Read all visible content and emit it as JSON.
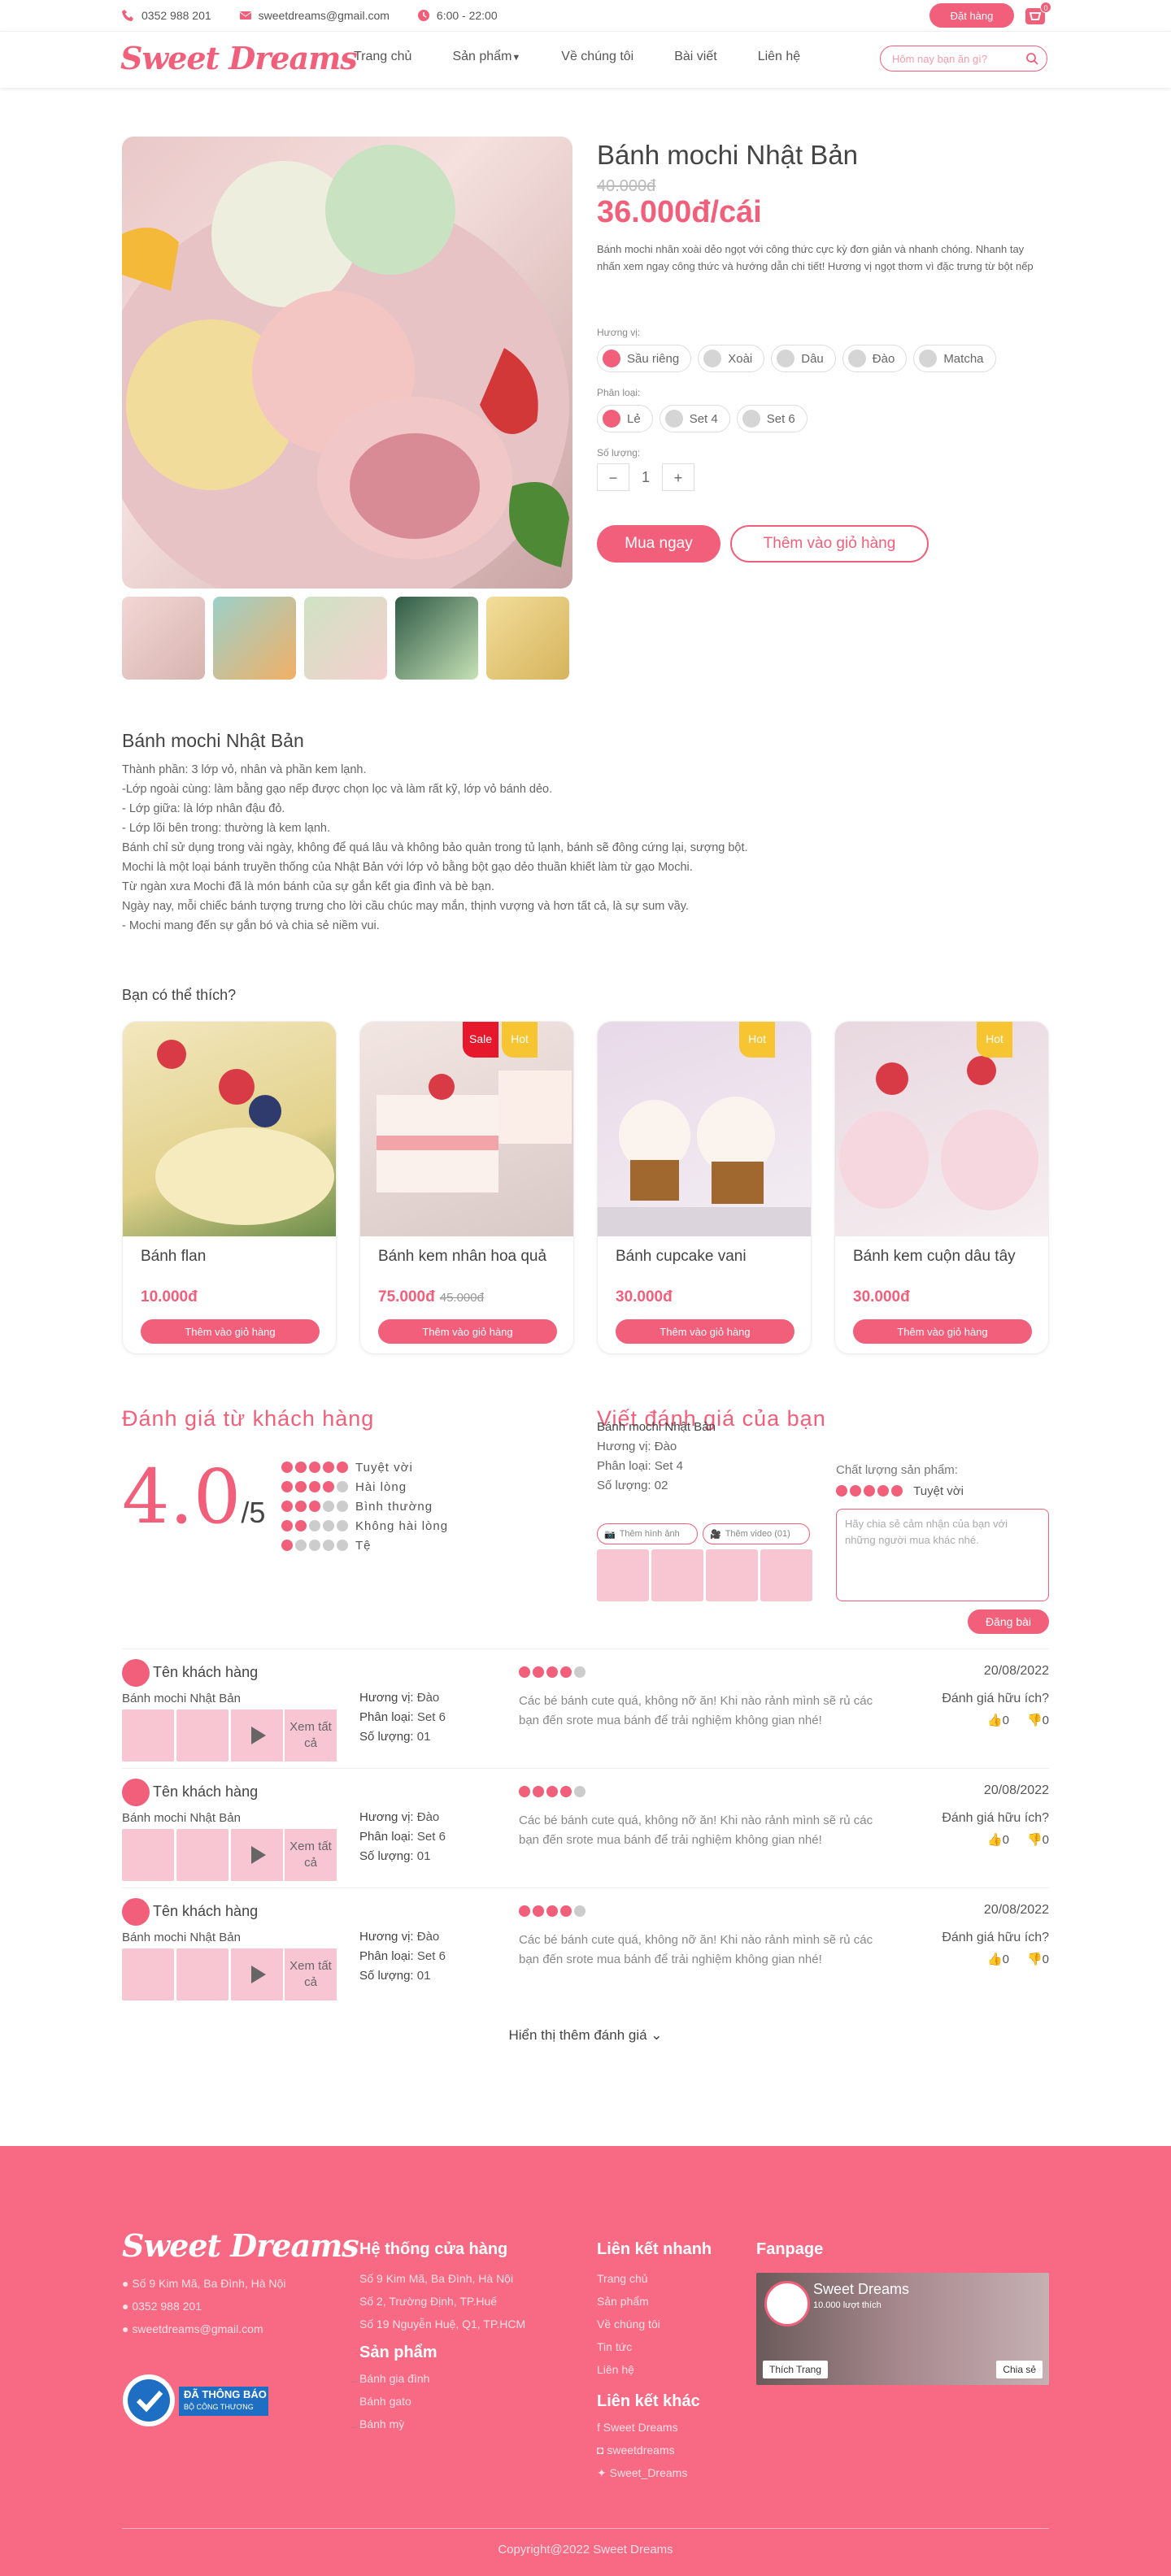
{
  "topbar": {
    "phone": "0352 988 201",
    "email": "sweetdreams@gmail.com",
    "hours": "6:00 - 22:00",
    "order_label": "Đặt hàng",
    "cart_count": "0"
  },
  "nav": {
    "logo": "Sweet Dreams",
    "items": [
      "Trang chủ",
      "Sản phẩm",
      "Về chúng tôi",
      "Bài viết",
      "Liên hệ"
    ],
    "search_placeholder": "Hôm nay bạn ăn gì?"
  },
  "product": {
    "title": "Bánh mochi Nhật Bản",
    "old_price": "40.000đ",
    "price": "36.000đ/cái",
    "description": "Bánh mochi nhân xoài dẻo ngọt với công thức cực kỳ đơn giản và nhanh chóng. Nhanh tay nhấn xem ngay công thức và hướng dẫn chi tiết! Hương vị ngọt thơm vì đặc trưng từ bột nếp",
    "flavor_label": "Hương vị:",
    "flavors": [
      "Sầu riêng",
      "Xoài",
      "Dâu",
      "Đào",
      "Matcha"
    ],
    "type_label": "Phân loại:",
    "types": [
      "Lẻ",
      "Set 4",
      "Set 6"
    ],
    "qty_label": "Số lượng:",
    "qty": "1",
    "buy_label": "Mua ngay",
    "add_label": "Thêm vào giỏ hàng"
  },
  "details": {
    "title": "Bánh mochi Nhật Bản",
    "lines": [
      "Thành phần: 3 lớp vỏ, nhân và phần kem lạnh.",
      "-Lớp ngoài cùng: làm bằng gạo nếp được chọn lọc và làm rất kỹ, lớp vỏ bánh dẻo.",
      "- Lớp giữa: là lớp nhân đậu đỏ.",
      "- Lớp lõi bên trong: thường là kem lạnh.",
      "Bánh chỉ sử dụng trong vài ngày, không để quá lâu và không bảo quản trong tủ lạnh, bánh sẽ đông cứng lại, sượng bột.",
      "Mochi là một loại bánh truyền thống của Nhật Bản với lớp vỏ bằng bột gạo dẻo thuần khiết làm từ gạo Mochi.",
      "Từ ngàn xưa Mochi đã là món bánh của sự gắn kết gia đình và bè bạn.",
      "Ngày nay, mỗi chiếc bánh tượng trưng cho lời cầu chúc may mắn, thịnh vượng và hơn tất cả, là sự sum vầy.",
      "- Mochi mang đến sự gắn bó và chia sẻ niềm vui."
    ]
  },
  "suggest": {
    "title": "Bạn có thể thích?",
    "cards": [
      {
        "name": "Bánh flan",
        "price": "10.000đ",
        "old": "",
        "sale": "",
        "hot": "",
        "button": "Thêm vào giỏ hàng"
      },
      {
        "name": "Bánh kem nhân hoa quả",
        "price": "75.000đ",
        "old": "45.000đ",
        "sale": "Sale",
        "hot": "Hot",
        "button": "Thêm vào giỏ hàng"
      },
      {
        "name": "Bánh cupcake vani",
        "price": "30.000đ",
        "old": "",
        "sale": "",
        "hot": "Hot",
        "button": "Thêm vào giỏ hàng"
      },
      {
        "name": "Bánh kem cuộn dâu tây",
        "price": "30.000đ",
        "old": "",
        "sale": "",
        "hot": "Hot",
        "button": "Thêm vào giỏ hàng"
      }
    ]
  },
  "ratings": {
    "title": "Đánh giá từ khách hàng",
    "score": "4.0",
    "out_of": "/5",
    "rows": [
      {
        "label": "Tuyệt vời",
        "stars": 5
      },
      {
        "label": "Hài lòng",
        "stars": 4
      },
      {
        "label": "Bình thường",
        "stars": 3
      },
      {
        "label": "Không hài lòng",
        "stars": 2
      },
      {
        "label": "Tệ",
        "stars": 1
      }
    ]
  },
  "write": {
    "title": "Viết đánh giá của bạn",
    "product": "Bánh mochi Nhật Bản",
    "flavor": "Hương vị: Đào",
    "type": "Phân loại: Set 4",
    "qty": "Số lượng: 02",
    "photo_btn": "Thêm hình ảnh",
    "video_btn": "Thêm video (01)",
    "quality_label": "Chất lượng sản phẩm:",
    "quality_value": "Tuyệt vời",
    "placeholder": "Hãy chia sẻ cảm nhận của bạn với những người mua khác nhé.",
    "post_label": "Đăng bài"
  },
  "reviews": [
    {
      "name": "Tên khách hàng",
      "product": "Bánh mochi Nhật Bản",
      "more": "Xem tất cả",
      "flavor_k": "Hương vị:",
      "flavor": "Đào",
      "type_k": "Phân loại:",
      "type": "Set 6",
      "qty_k": "Số lượng:",
      "qty": "01",
      "text": "Các bé bánh cute quá, không nỡ ăn! Khi nào rảnh mình sẽ rủ các bạn đến srote mua bánh để trải nghiệm không gian nhé!",
      "date": "20/08/2022",
      "helpful": "Đánh giá hữu ích?",
      "up": "0",
      "down": "0",
      "stars": 4
    },
    {
      "name": "Tên khách hàng",
      "product": "Bánh mochi Nhật Bản",
      "more": "Xem tất cả",
      "flavor_k": "Hương vị:",
      "flavor": "Đào",
      "type_k": "Phân loại:",
      "type": "Set 6",
      "qty_k": "Số lượng:",
      "qty": "01",
      "text": "Các bé bánh cute quá, không nỡ ăn! Khi nào rảnh mình sẽ rủ các bạn đến srote mua bánh để trải nghiệm không gian nhé!",
      "date": "20/08/2022",
      "helpful": "Đánh giá hữu ích?",
      "up": "0",
      "down": "0",
      "stars": 4
    },
    {
      "name": "Tên khách hàng",
      "product": "Bánh mochi Nhật Bản",
      "more": "Xem tất cả",
      "flavor_k": "Hương vị:",
      "flavor": "Đào",
      "type_k": "Phân loại:",
      "type": "Set 6",
      "qty_k": "Số lượng:",
      "qty": "01",
      "text": "Các bé bánh cute quá, không nỡ ăn! Khi nào rảnh mình sẽ rủ các bạn đến srote mua bánh để trải nghiệm không gian nhé!",
      "date": "20/08/2022",
      "helpful": "Đánh giá hữu ích?",
      "up": "0",
      "down": "0",
      "stars": 4
    }
  ],
  "show_more": "Hiển thị thêm đánh giá",
  "footer": {
    "logo": "Sweet Dreams",
    "address": "Số 9 Kim Mã, Ba Đình, Hà Nội",
    "phone": "0352 988 201",
    "email": "sweetdreams@gmail.com",
    "bct_line1": "ĐÃ THÔNG BÁO",
    "bct_line2": "BỘ CÔNG THƯƠNG",
    "stores_title": "Hệ thống cửa hàng",
    "stores": [
      "Số 9 Kim Mã, Ba Đình, Hà Nội",
      "Số 2, Trường Định, TP.Huế",
      "Số 19 Nguyễn Huệ, Q1, TP.HCM"
    ],
    "products_title": "Sản phẩm",
    "products": [
      "Bánh gia đình",
      "Bánh gato",
      "Bánh mỳ"
    ],
    "quick_title": "Liên kết nhanh",
    "quick": [
      "Trang chủ",
      "Sản phẩm",
      "Về chúng tôi",
      "Tin tức",
      "Liên hệ"
    ],
    "other_title": "Liên kết khác",
    "other": [
      "Sweet Dreams",
      "sweetdreams",
      "Sweet_Dreams"
    ],
    "fanpage_title": "Fanpage",
    "fan_name": "Sweet Dreams",
    "fan_likes": "10.000 lượt thích",
    "fan_like_btn": "Thích Trang",
    "fan_share_btn": "Chia sẻ",
    "copyright": "Copyright@2022 Sweet Dreams"
  },
  "colors": {
    "accent": "#f25f7a",
    "footer": "#f86983",
    "media": "#f8c6d2"
  }
}
